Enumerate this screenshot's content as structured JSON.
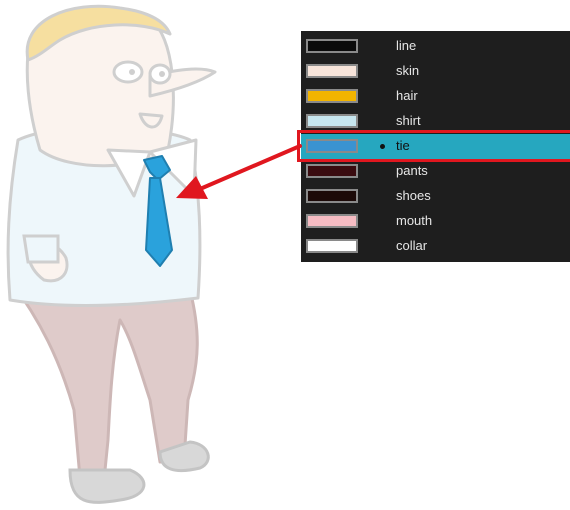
{
  "palette": {
    "colors": [
      {
        "name": "line",
        "swatch": "#0b0b0b",
        "selected": false
      },
      {
        "name": "skin",
        "swatch": "#f7e4da",
        "selected": false
      },
      {
        "name": "hair",
        "swatch": "#f2b400",
        "selected": false
      },
      {
        "name": "shirt",
        "swatch": "#c7e6ef",
        "selected": false
      },
      {
        "name": "tie",
        "swatch": "#3a93d1",
        "selected": true
      },
      {
        "name": "pants",
        "swatch": "#3a0c10",
        "selected": false
      },
      {
        "name": "shoes",
        "swatch": "#1c0a08",
        "selected": false
      },
      {
        "name": "mouth",
        "swatch": "#f6bcc3",
        "selected": false
      },
      {
        "name": "collar",
        "swatch": "#ffffff",
        "selected": false
      }
    ]
  },
  "colors": {
    "panel_bg": "#1e1e1e",
    "selection_bg": "#26a7bf",
    "highlight_border": "#e0171f",
    "arrow": "#e0171f",
    "tie": "#2aa2dc",
    "hair": "#f6dfa0",
    "shirt": "#eef7fb",
    "pants": "#dcc7c6",
    "outline": "#d0d0d0"
  }
}
